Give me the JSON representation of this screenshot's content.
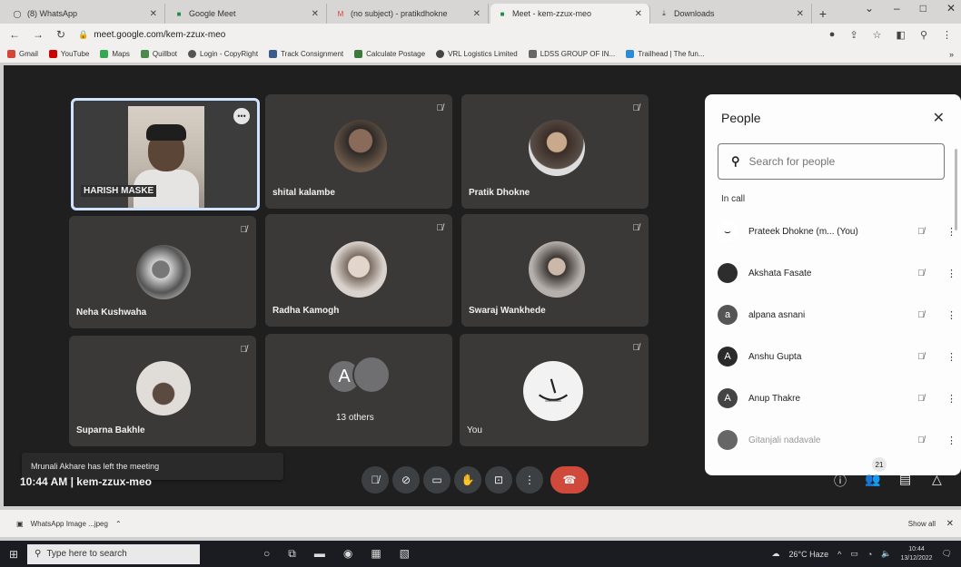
{
  "browser": {
    "tabs": [
      {
        "label": "(8) WhatsApp",
        "icon": "whatsapp-icon"
      },
      {
        "label": "Google Meet",
        "icon": "meet-icon"
      },
      {
        "label": "(no subject) - pratikdhokne",
        "icon": "gmail-icon"
      },
      {
        "label": "Meet - kem-zzux-meo",
        "icon": "meet-icon"
      },
      {
        "label": "Downloads",
        "icon": "download-icon"
      }
    ],
    "url": "meet.google.com/kem-zzux-meo",
    "bookmarks": [
      {
        "label": "Gmail",
        "color": "#d44638"
      },
      {
        "label": "YouTube",
        "color": "#cc0000"
      },
      {
        "label": "Maps",
        "color": "#34a853"
      },
      {
        "label": "Quillbot",
        "color": "#4b8a4b"
      },
      {
        "label": "Login - CopyRight",
        "color": "#555555"
      },
      {
        "label": "Track Consignment",
        "color": "#3b5b8a"
      },
      {
        "label": "Calculate Postage",
        "color": "#3b7a3b"
      },
      {
        "label": "VRL Logistics Limited",
        "color": "#444444"
      },
      {
        "label": "LDSS GROUP OF IN...",
        "color": "#666666"
      },
      {
        "label": "Trailhead | The fun...",
        "color": "#2a8bd8"
      }
    ]
  },
  "meet": {
    "tiles": [
      {
        "name": "HARISH MASKE"
      },
      {
        "name": "shital kalambe"
      },
      {
        "name": "Pratik Dhokne"
      },
      {
        "name": "Neha Kushwaha"
      },
      {
        "name": "Radha Kamogh"
      },
      {
        "name": "Swaraj Wankhede"
      },
      {
        "name": "Suparna Bakhle"
      },
      {
        "name": "13 others",
        "letter": "A"
      },
      {
        "name": "You"
      }
    ],
    "toast": "Mrunali Akhare has left the meeting",
    "time": "10:44 AM",
    "meeting_code": "kem-zzux-meo",
    "participant_count": "21"
  },
  "people_panel": {
    "title": "People",
    "search_placeholder": "Search for people",
    "section": "In call",
    "people": [
      {
        "name": "Prateek Dhokne (m... (You)",
        "initial": ""
      },
      {
        "name": "Akshata Fasate",
        "initial": ""
      },
      {
        "name": "alpana asnani",
        "initial": "a"
      },
      {
        "name": "Anshu Gupta",
        "initial": "A"
      },
      {
        "name": "Anup Thakre",
        "initial": "A"
      },
      {
        "name": "Gitanjali nadavale",
        "initial": ""
      }
    ]
  },
  "downloads": {
    "file": "WhatsApp Image ...jpeg",
    "show_all": "Show all"
  },
  "taskbar": {
    "search_placeholder": "Type here to search",
    "weather": "26°C Haze",
    "time": "10:44",
    "date": "13/12/2022"
  }
}
